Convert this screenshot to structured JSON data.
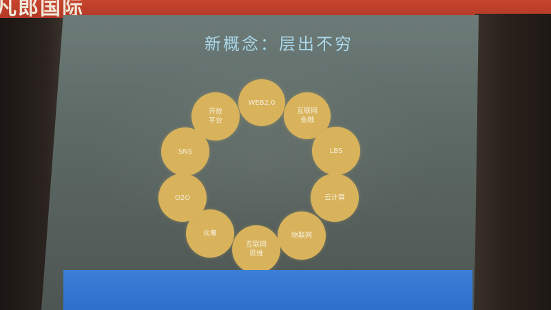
{
  "banner": {
    "text": "凡郎国际"
  },
  "slide": {
    "title": "新概念：层出不穷",
    "items": [
      {
        "label": "WEB2.0"
      },
      {
        "label": "互联网\n金融"
      },
      {
        "label": "LBS"
      },
      {
        "label": "云计算"
      },
      {
        "label": "物联网"
      },
      {
        "label": "互联网\n思维"
      },
      {
        "label": "众筹"
      },
      {
        "label": "O2O"
      },
      {
        "label": "SNS"
      },
      {
        "label": "开放\n平台"
      }
    ],
    "colors": {
      "circle": "#d8b35c",
      "title": "#a9d8ea",
      "bottom_bar": "#2f6fcd",
      "banner": "#b23a27"
    }
  }
}
